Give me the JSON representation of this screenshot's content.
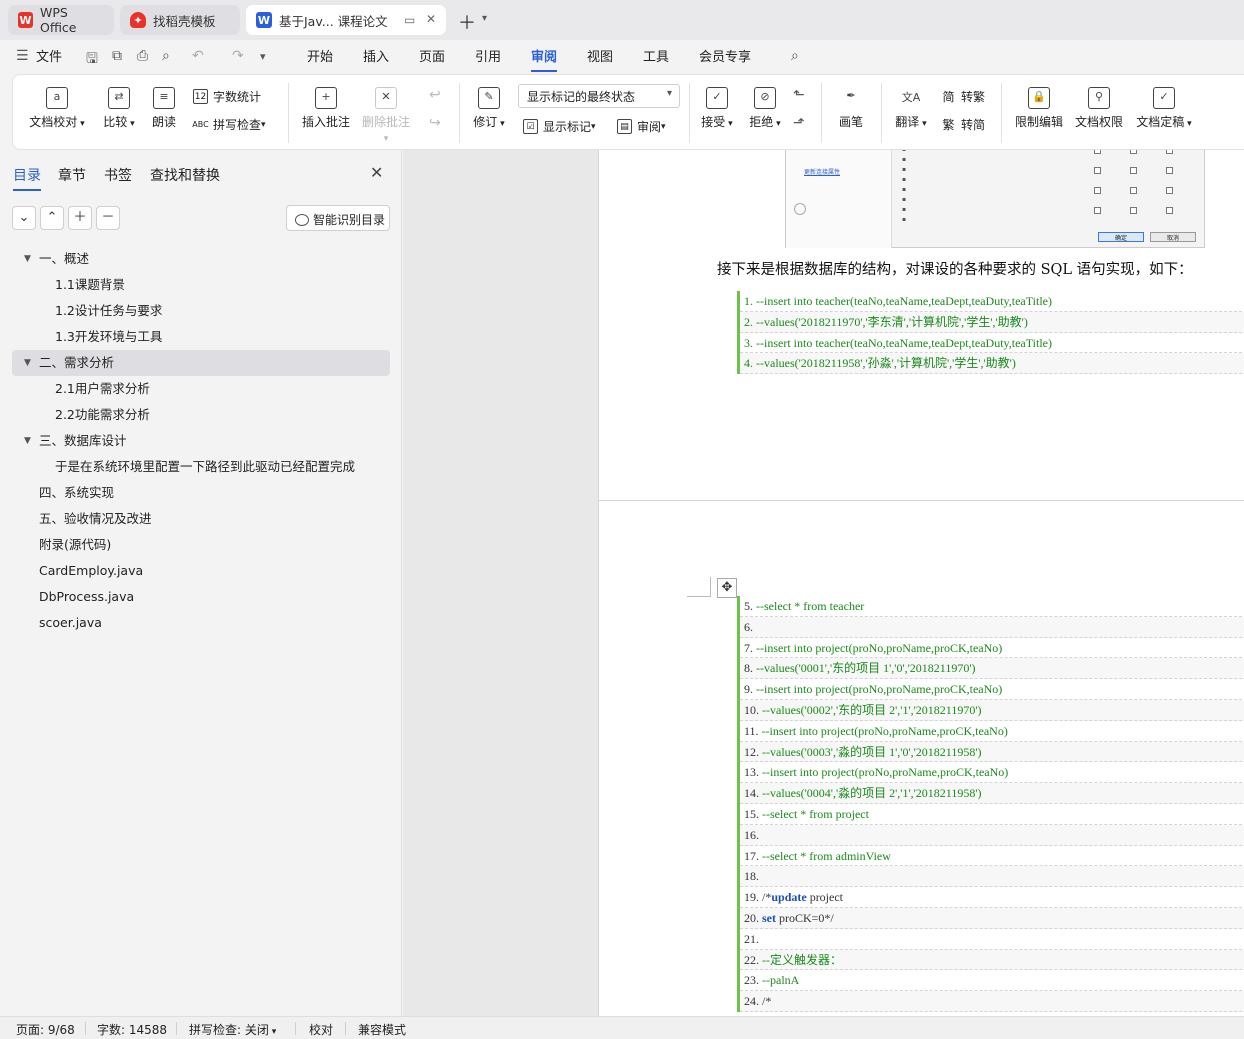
{
  "tabs": [
    {
      "label": "WPS Office",
      "icon": "wps-logo-icon"
    },
    {
      "label": "找稻壳模板",
      "icon": "docer-logo-icon"
    },
    {
      "label": "基于Jav... 课程论文",
      "icon": "writer-doc-icon",
      "active": true
    }
  ],
  "menu": {
    "file": "文件",
    "items": [
      "开始",
      "插入",
      "页面",
      "引用",
      "审阅",
      "视图",
      "工具",
      "会员专享"
    ],
    "active": "审阅"
  },
  "ribbon": {
    "doc_proofread": "文档校对",
    "compare": "比较",
    "read_aloud": "朗读",
    "word_count": "字数统计",
    "spell_check": "拼写检查",
    "insert_comment": "插入批注",
    "delete_comment": "删除批注",
    "track_changes": "修订",
    "markup_state": "显示标记的最终状态",
    "show_markup": "显示标记",
    "review": "审阅",
    "accept": "接受",
    "reject": "拒绝",
    "pen": "画笔",
    "translate": "翻译",
    "to_traditional": "转繁",
    "to_simplified": "转简",
    "restrict_edit": "限制编辑",
    "doc_permission": "文档权限",
    "doc_finalize": "文档定稿"
  },
  "nav": {
    "tabs": [
      "目录",
      "章节",
      "书签",
      "查找和替换"
    ],
    "smart_toc": "智能识别目录",
    "toc": [
      {
        "label": "一、概述",
        "level": 1,
        "caret": true
      },
      {
        "label": "1.1课题背景",
        "level": 2
      },
      {
        "label": "1.2设计任务与要求",
        "level": 2
      },
      {
        "label": "1.3开发环境与工具",
        "level": 2
      },
      {
        "label": "二、需求分析",
        "level": 1,
        "caret": true,
        "selected": true
      },
      {
        "label": "2.1用户需求分析",
        "level": 2
      },
      {
        "label": "2.2功能需求分析",
        "level": 2
      },
      {
        "label": "三、数据库设计",
        "level": 1,
        "caret": true
      },
      {
        "label": "于是在系统环境里配置一下路径到此驱动已经配置完成",
        "level": 2
      },
      {
        "label": "四、系统实现",
        "level": 1
      },
      {
        "label": "五、验收情况及改进",
        "level": 1
      },
      {
        "label": "附录(源代码)",
        "level": 1
      },
      {
        "label": "CardEmploy.java",
        "level": 1
      },
      {
        "label": "DbProcess.java",
        "level": 1
      },
      {
        "label": "scoer.java",
        "level": 1
      }
    ]
  },
  "doc": {
    "embedded_link": "更新连接属性",
    "embedded_ok": "确定",
    "embedded_cancel": "取消",
    "paragraph": "接下来是根据数据库的结构，对课设的各种要求的 SQL 语句实现，如下：",
    "code_block_1": [
      "1. --insert into teacher(teaNo,teaName,teaDept,teaDuty,teaTitle)",
      "2. --values('2018211970','李东清','计算机院','学生','助教')",
      "3. --insert into teacher(teaNo,teaName,teaDept,teaDuty,teaTitle)",
      "4. --values('2018211958','孙淼','计算机院','学生','助教')"
    ],
    "code_block_2": [
      {
        "n": "5. ",
        "t": "--select * from teacher"
      },
      {
        "n": "6. ",
        "t": ""
      },
      {
        "n": "7. ",
        "t": "--insert into project(proNo,proName,proCK,teaNo)"
      },
      {
        "n": "8. ",
        "t": "--values('0001','东的项目 1','0','2018211970')"
      },
      {
        "n": "9. ",
        "t": "--insert into project(proNo,proName,proCK,teaNo)"
      },
      {
        "n": "10. ",
        "t": "--values('0002','东的项目 2','1','2018211970')"
      },
      {
        "n": "11. ",
        "t": "--insert into project(proNo,proName,proCK,teaNo)"
      },
      {
        "n": "12. ",
        "t": "--values('0003','淼的项目 1','0','2018211958')"
      },
      {
        "n": "13. ",
        "t": "--insert into project(proNo,proName,proCK,teaNo)"
      },
      {
        "n": "14. ",
        "t": "--values('0004','淼的项目 2','1','2018211958')"
      },
      {
        "n": "15. ",
        "t": "--select * from project"
      },
      {
        "n": "16. ",
        "t": ""
      },
      {
        "n": "17. ",
        "t": "--select * from adminView"
      },
      {
        "n": "18. ",
        "t": ""
      },
      {
        "n": "19. ",
        "pre": "/*",
        "kw": "update",
        "post": " project"
      },
      {
        "n": "20. ",
        "kw": "set",
        "post": " proCK=0*/"
      },
      {
        "n": "21. ",
        "t": ""
      },
      {
        "n": "22. ",
        "t": "--定义触发器："
      },
      {
        "n": "23. ",
        "t": "--palnA"
      },
      {
        "n": "24. ",
        "pre": "/*"
      }
    ]
  },
  "status": {
    "page": "页面: 9/68",
    "words": "字数: 14588",
    "spell": "拼写检查: 关闭",
    "proof": "校对",
    "compat": "兼容模式"
  },
  "colors": {
    "accent": "#2b5fd9",
    "code_bar": "#6cc24a",
    "comment": "#1a8a1a",
    "keyword": "#1d4fb8"
  }
}
